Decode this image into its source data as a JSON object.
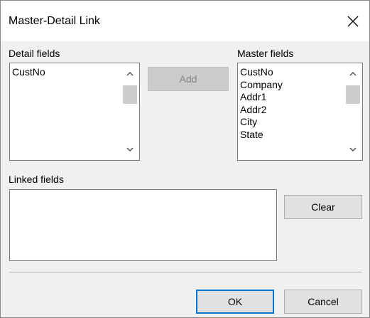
{
  "dialog": {
    "title": "Master-Detail Link",
    "close_icon": "close-icon"
  },
  "detail": {
    "label": "Detail fields",
    "items": [
      "CustNo"
    ]
  },
  "master": {
    "label": "Master fields",
    "items": [
      "CustNo",
      "Company",
      "Addr1",
      "Addr2",
      "City",
      "State"
    ]
  },
  "linked": {
    "label": "Linked fields",
    "items": []
  },
  "buttons": {
    "add": "Add",
    "clear": "Clear",
    "ok": "OK",
    "cancel": "Cancel"
  },
  "colors": {
    "focus_border": "#0078d7",
    "dialog_bg": "#f0f0f0"
  }
}
